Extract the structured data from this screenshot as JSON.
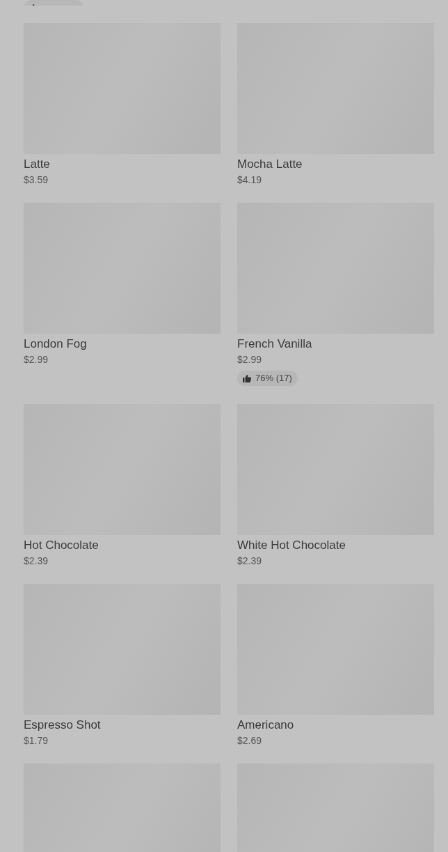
{
  "top_rating": {
    "kind": "cut"
  },
  "products": [
    {
      "kind": "product",
      "name": "Latte",
      "price": "$3.59"
    },
    {
      "kind": "product",
      "name": "Mocha Latte",
      "price": "$4.19"
    },
    {
      "kind": "product",
      "name": "London Fog",
      "price": "$2.99"
    },
    {
      "kind": "product",
      "name": "French Vanilla",
      "price": "$2.99",
      "rating": "76% (17)"
    },
    {
      "kind": "product",
      "name": "Hot Chocolate",
      "price": "$2.39"
    },
    {
      "kind": "product",
      "name": "White Hot Chocolate",
      "price": "$2.39"
    },
    {
      "kind": "product",
      "name": "Espresso Shot",
      "price": "$1.79"
    },
    {
      "kind": "product",
      "name": "Americano",
      "price": "$2.69"
    },
    {
      "kind": "picture"
    },
    {
      "kind": "picture"
    }
  ]
}
